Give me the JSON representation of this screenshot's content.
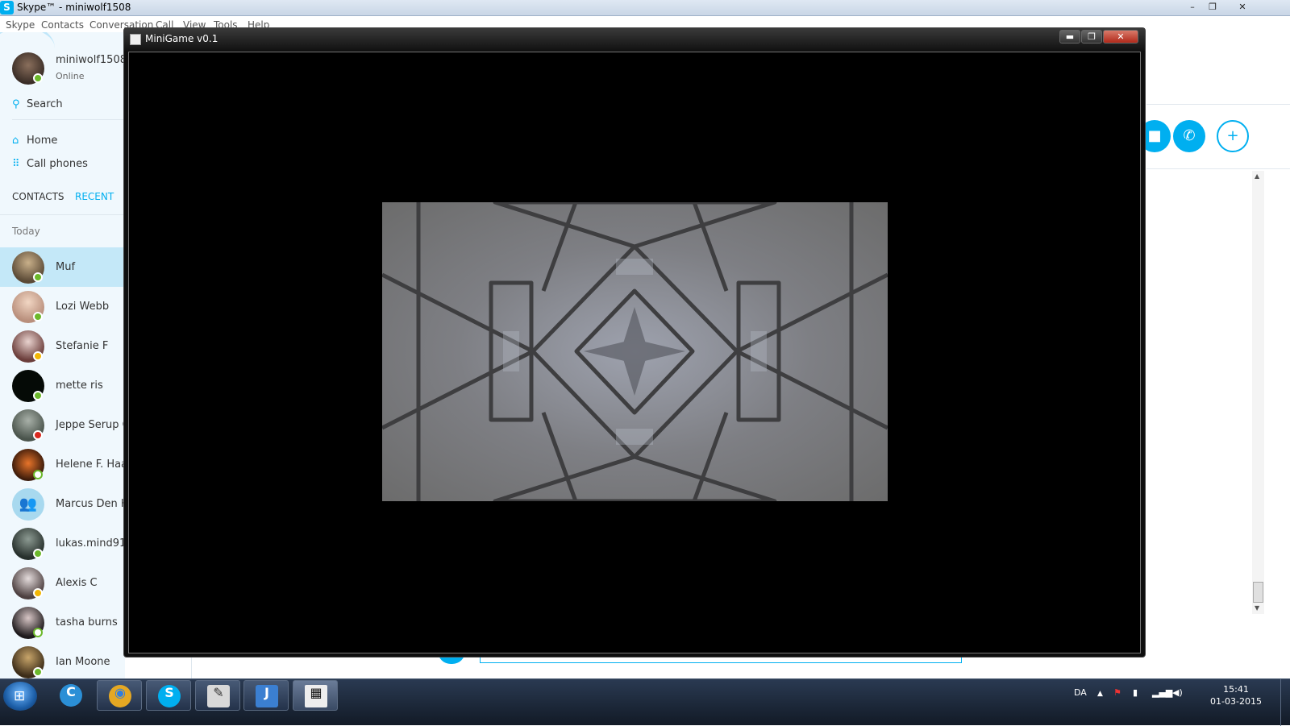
{
  "skype": {
    "title": "Skype™ - miniwolf1508",
    "logo_letter": "S",
    "menu": [
      "Skype",
      "Contacts",
      "Conversation",
      "Call",
      "View",
      "Tools",
      "Help"
    ],
    "window_buttons": [
      "–",
      "❐",
      "✕"
    ]
  },
  "profile": {
    "name": "miniwolf1508",
    "status": "Online"
  },
  "sidebar": {
    "search": "Search",
    "nav": [
      {
        "label": "Home",
        "icon": "home-icon"
      },
      {
        "label": "Call phones",
        "icon": "dialpad-icon"
      }
    ],
    "tabs": {
      "contacts": "CONTACTS",
      "recent": "RECENT"
    },
    "section": "Today",
    "contacts": [
      {
        "name": "Muf",
        "status": "online",
        "selected": true
      },
      {
        "name": "Lozi Webb",
        "status": "online"
      },
      {
        "name": "Stefanie F",
        "status": "away"
      },
      {
        "name": "mette ris",
        "status": "online"
      },
      {
        "name": "Jeppe Serup C",
        "status": "dnd"
      },
      {
        "name": "Helene F.  Haa",
        "status": "offline"
      },
      {
        "name": "Marcus Den H",
        "status": "none"
      },
      {
        "name": "lukas.mind91",
        "status": "online"
      },
      {
        "name": "Alexis  C",
        "status": "away"
      },
      {
        "name": "tasha burns",
        "status": "offline"
      },
      {
        "name": "Ian Moone",
        "status": "online"
      }
    ]
  },
  "actions": {
    "video": "video-call-icon",
    "call": "phone-icon",
    "add": "add-contact-icon"
  },
  "game": {
    "title": "MiniGame v0.1",
    "buttons": [
      "▬",
      "❐",
      "✕"
    ]
  },
  "taskbar": {
    "apps": [
      {
        "name": "ccleaner",
        "glyph": "C",
        "color": "#2b8fd6"
      },
      {
        "name": "chrome",
        "glyph": "◉",
        "color": "#e5a823"
      },
      {
        "name": "skype",
        "glyph": "S",
        "color": "#00aff0"
      },
      {
        "name": "notepad",
        "glyph": "✎",
        "color": "#d8d8d8"
      },
      {
        "name": "intellij",
        "glyph": "J",
        "color": "#3b7fd1"
      },
      {
        "name": "minigame",
        "glyph": "▦",
        "color": "#eeeeee"
      }
    ],
    "language": "DA",
    "time": "15:41",
    "date": "01-03-2015"
  }
}
